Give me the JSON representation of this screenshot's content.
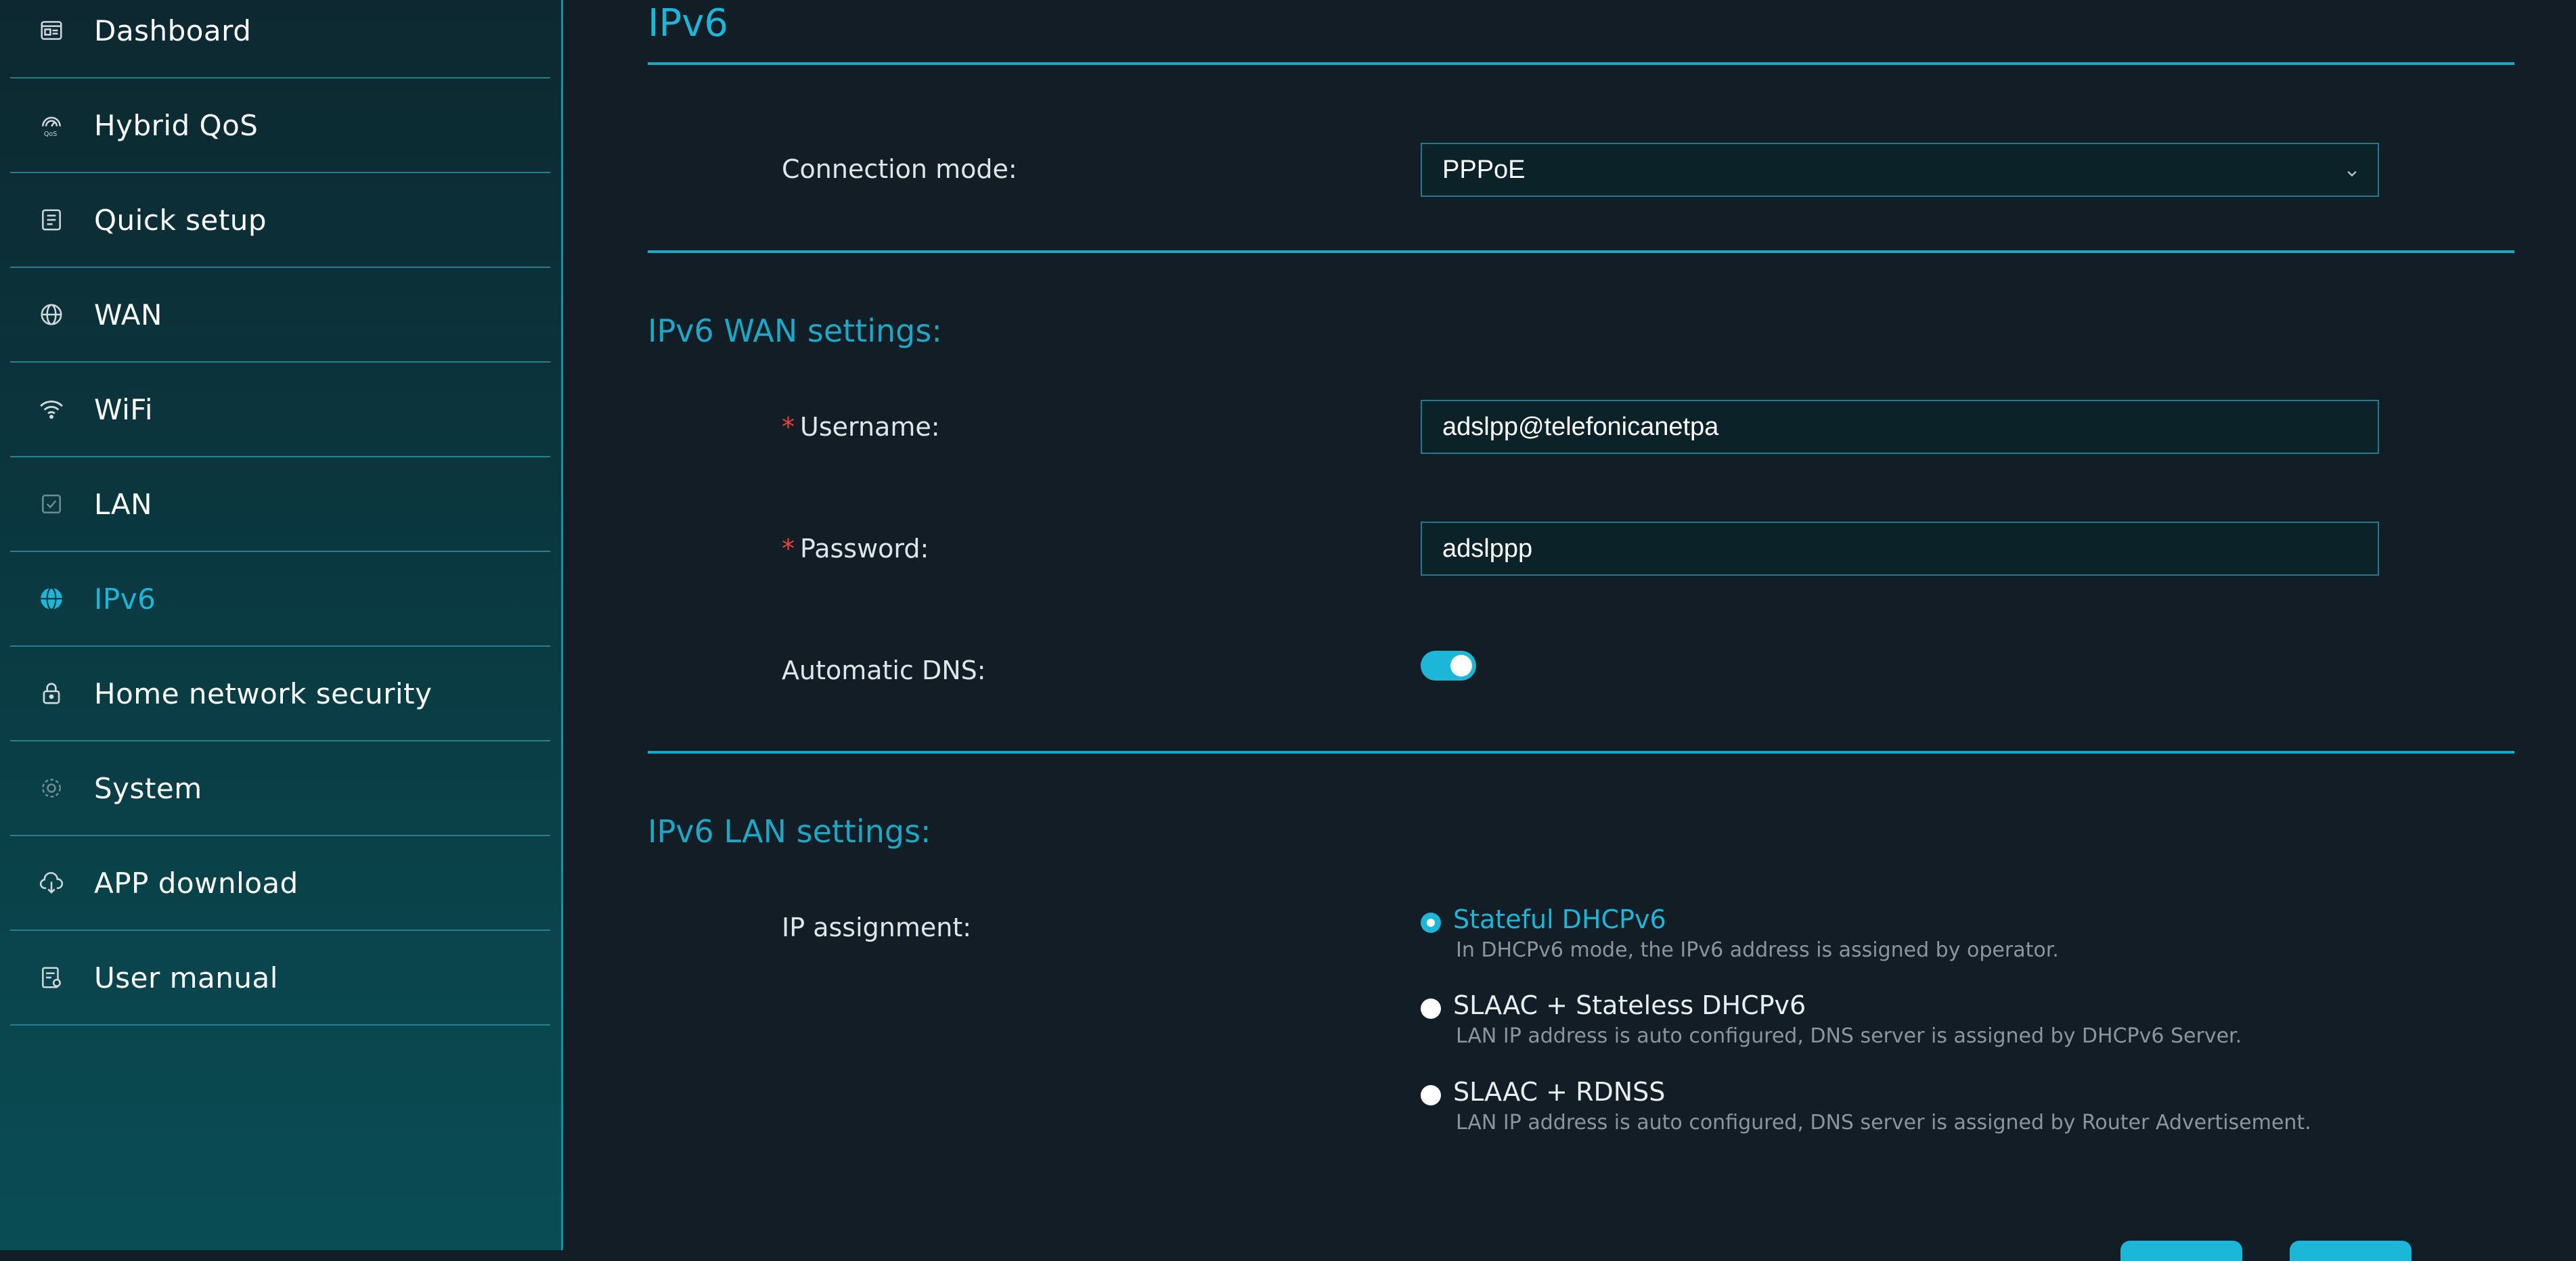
{
  "sidebar": {
    "items": [
      {
        "label": "Dashboard",
        "icon": "dashboard-icon",
        "active": false
      },
      {
        "label": "Hybrid QoS",
        "icon": "qos-icon",
        "active": false
      },
      {
        "label": "Quick setup",
        "icon": "quick-setup-icon",
        "active": false
      },
      {
        "label": "WAN",
        "icon": "globe-icon",
        "active": false
      },
      {
        "label": "WiFi",
        "icon": "wifi-icon",
        "active": false
      },
      {
        "label": "LAN",
        "icon": "lan-icon",
        "active": false
      },
      {
        "label": "IPv6",
        "icon": "globe-filled-icon",
        "active": true
      },
      {
        "label": "Home network security",
        "icon": "lock-icon",
        "active": false
      },
      {
        "label": "System",
        "icon": "gear-icon",
        "active": false
      },
      {
        "label": "APP download",
        "icon": "cloud-download-icon",
        "active": false
      },
      {
        "label": "User manual",
        "icon": "manual-icon",
        "active": false
      }
    ]
  },
  "page": {
    "title": "IPv6",
    "connection_mode": {
      "label": "Connection mode:",
      "value": "PPPoE"
    },
    "wan_section": {
      "title": "IPv6 WAN settings:",
      "username_label": "Username:",
      "username_value": "adslpp@telefonicanetpa",
      "password_label": "Password:",
      "password_value": "adslppp",
      "auto_dns_label": "Automatic DNS:",
      "auto_dns_on": true
    },
    "lan_section": {
      "title": "IPv6 LAN settings:",
      "ip_assignment_label": "IP assignment:",
      "options": [
        {
          "title": "Stateful DHCPv6",
          "desc": "In DHCPv6 mode, the IPv6 address is assigned by operator.",
          "checked": true
        },
        {
          "title": "SLAAC + Stateless DHCPv6",
          "desc": "LAN IP address is auto configured, DNS server is assigned by DHCPv6 Server.",
          "checked": false
        },
        {
          "title": "SLAAC + RDNSS",
          "desc": "LAN IP address is auto configured, DNS server is assigned by Router Advertisement.",
          "checked": false
        }
      ]
    }
  },
  "colors": {
    "accent": "#1cb6d8",
    "background": "#121d26",
    "required": "#e8453c"
  }
}
